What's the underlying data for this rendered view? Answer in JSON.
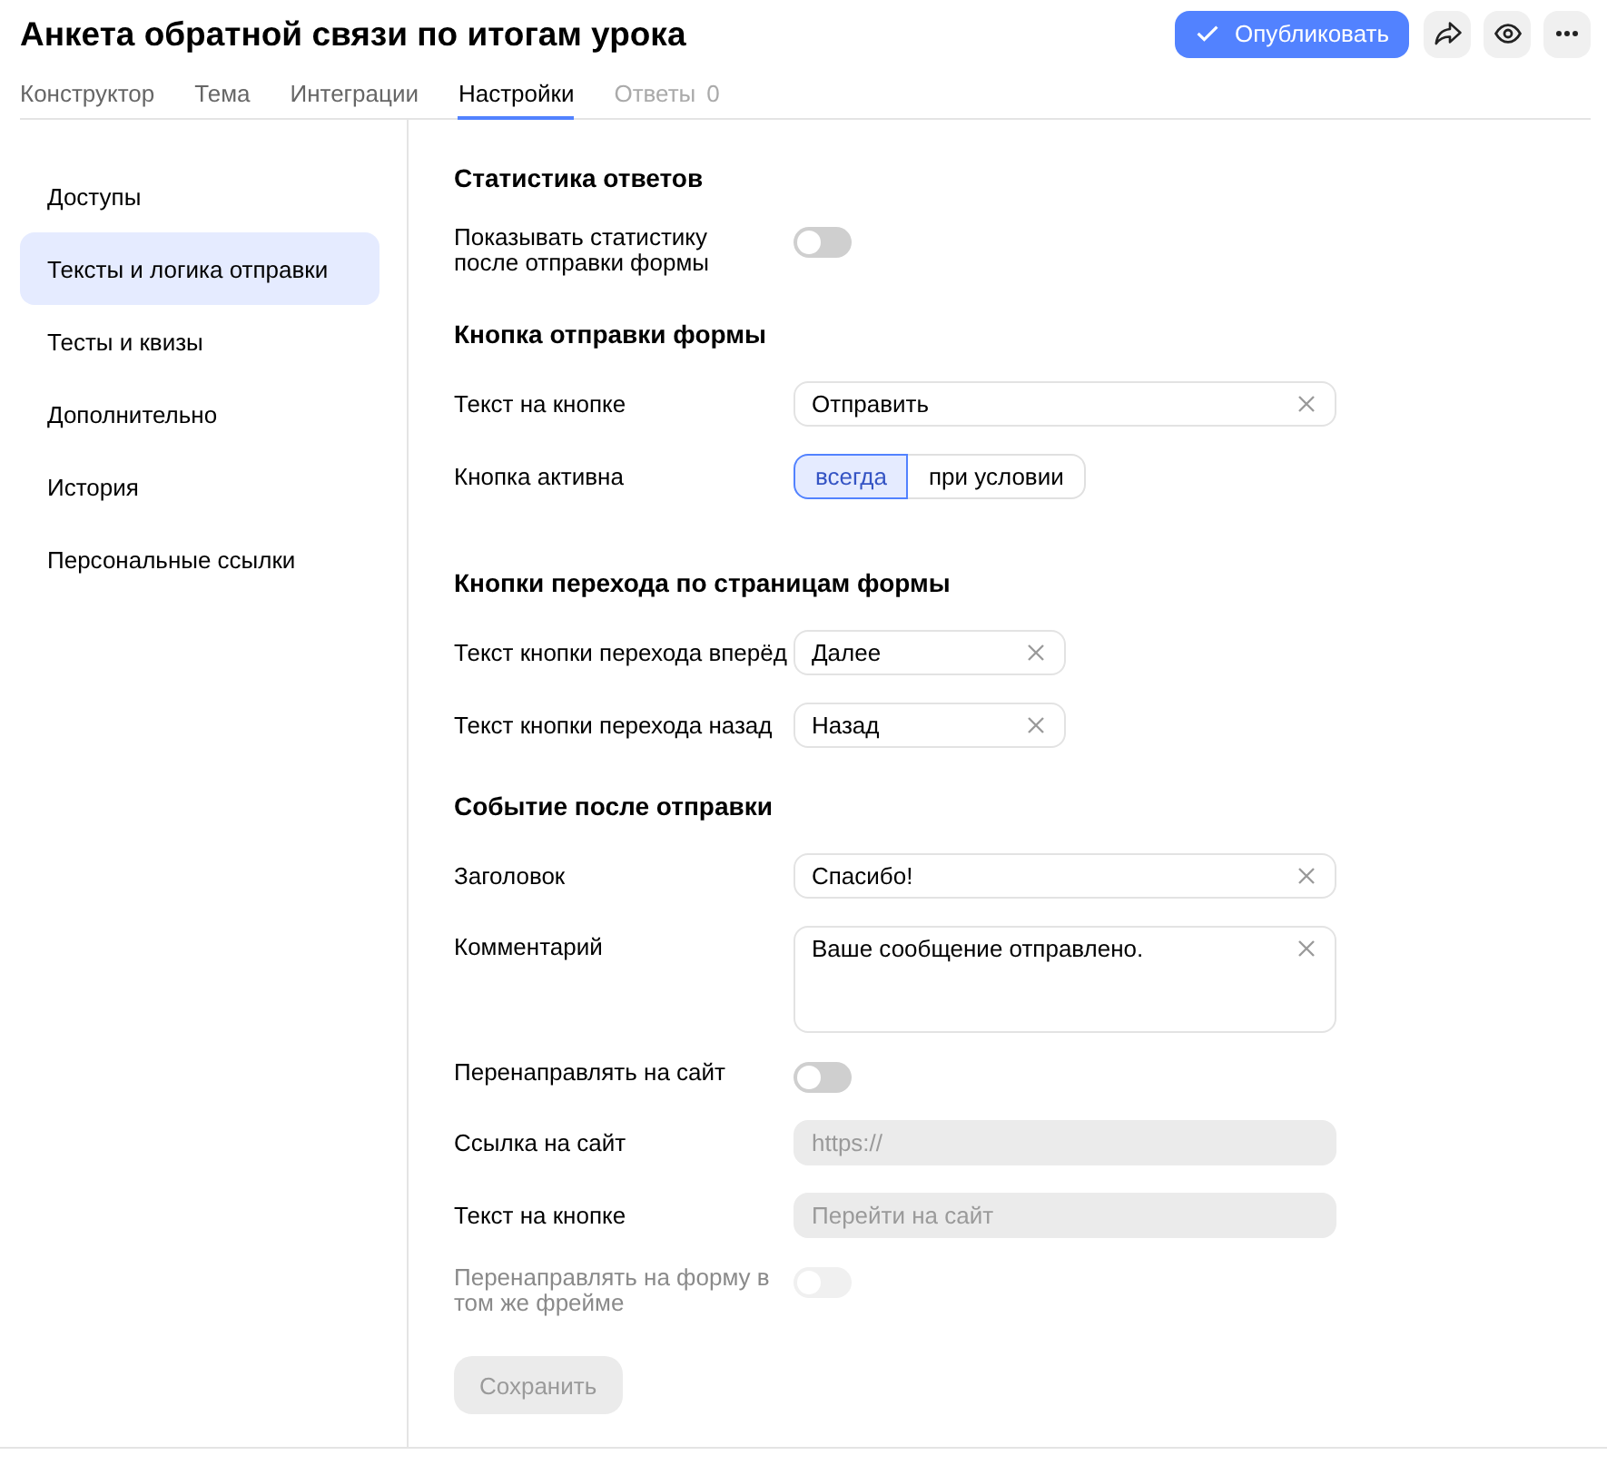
{
  "header": {
    "title": "Анкета обратной связи по итогам урока",
    "publish_button": "Опубликовать",
    "tabs": [
      {
        "label": "Конструктор",
        "selected": false,
        "disabled": false
      },
      {
        "label": "Тема",
        "selected": false,
        "disabled": false
      },
      {
        "label": "Интеграции",
        "selected": false,
        "disabled": false
      },
      {
        "label": "Настройки",
        "selected": true,
        "disabled": false
      },
      {
        "label": "Ответы",
        "count": "0",
        "selected": false,
        "disabled": true
      }
    ]
  },
  "sidebar": {
    "items": [
      {
        "label": "Доступы",
        "selected": false
      },
      {
        "label": "Тексты и логика отправки",
        "selected": true
      },
      {
        "label": "Тесты и квизы",
        "selected": false
      },
      {
        "label": "Дополнительно",
        "selected": false
      },
      {
        "label": "История",
        "selected": false
      },
      {
        "label": "Персональные ссылки",
        "selected": false
      }
    ]
  },
  "sections": [
    {
      "title": "Статистика ответов",
      "rows": [
        {
          "kind": "toggle",
          "label": "Показывать статистику после отправки формы",
          "on": false,
          "disabled": false
        }
      ]
    },
    {
      "title": "Кнопка отправки формы",
      "rows": [
        {
          "kind": "text_field",
          "label": "Текст на кнопке",
          "value": "Отправить",
          "disabled": false
        },
        {
          "kind": "segmented",
          "label": "Кнопка активна",
          "options": [
            {
              "label": "всегда",
              "selected": true
            },
            {
              "label": "при условии",
              "selected": false
            }
          ]
        }
      ]
    },
    {
      "title": "Кнопки перехода по страницам формы",
      "rows": [
        {
          "kind": "short_text_field",
          "label": "Текст кнопки перехода вперёд",
          "value": "Далее",
          "disabled": false
        },
        {
          "kind": "short_text_field",
          "label": "Текст кнопки перехода назад",
          "value": "Назад",
          "disabled": false
        }
      ]
    },
    {
      "title": "Событие после отправки",
      "rows": [
        {
          "kind": "text_field",
          "label": "Заголовок",
          "value": "Спасибо!",
          "disabled": false
        },
        {
          "kind": "text_area",
          "label": "Комментарий",
          "value": "Ваше сообщение отправлено.",
          "disabled": false
        },
        {
          "kind": "toggle",
          "label": "Перенаправлять на сайт",
          "on": false,
          "disabled": false
        },
        {
          "kind": "text_field",
          "label": "Ссылка на сайт",
          "placeholder": "https://",
          "disabled": true
        },
        {
          "kind": "text_field",
          "label": "Текст на кнопке",
          "placeholder": "Перейти на сайт",
          "disabled": true
        },
        {
          "kind": "toggle",
          "label": "Перенаправлять на форму в том же фрейме",
          "on": false,
          "disabled": true
        }
      ]
    }
  ],
  "save_button": {
    "label": "Сохранить",
    "disabled": true
  }
}
